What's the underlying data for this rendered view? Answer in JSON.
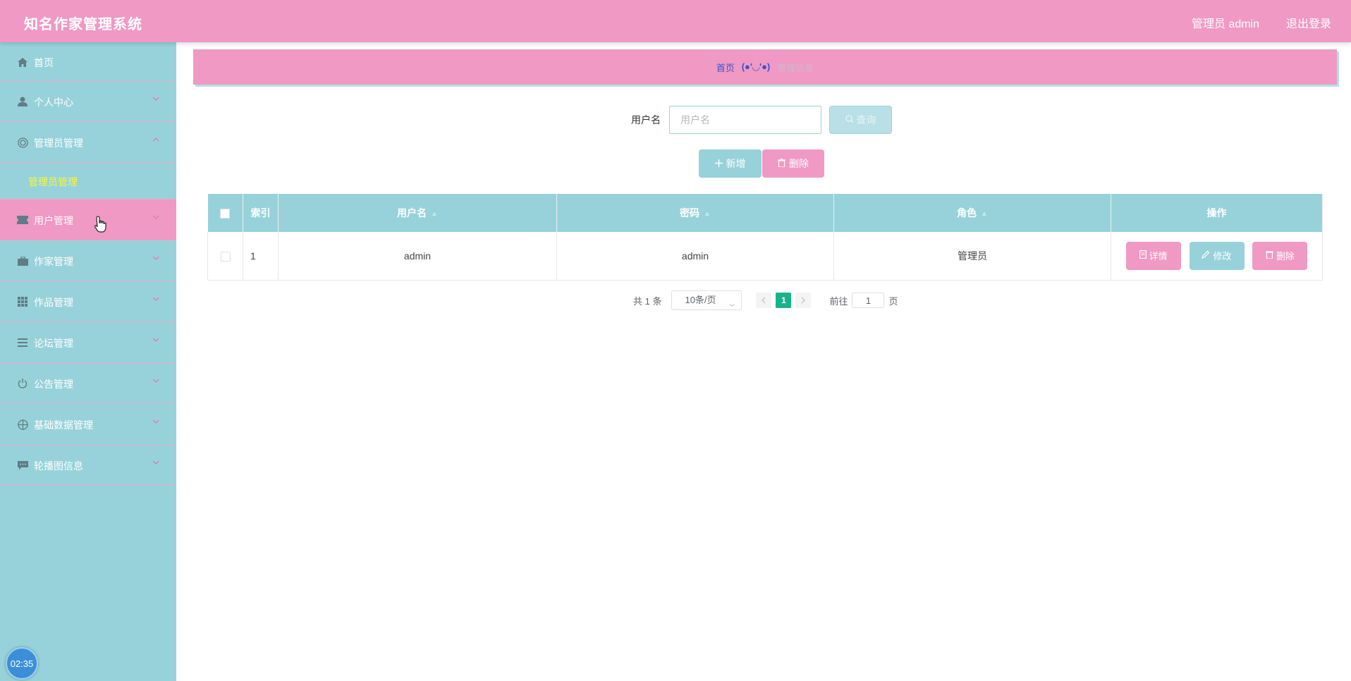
{
  "header": {
    "title": "知名作家管理系统",
    "user": "管理员 admin",
    "logout": "退出登录"
  },
  "sidebar": {
    "items": [
      {
        "label": "首页",
        "icon": "home-icon"
      },
      {
        "label": "个人中心",
        "icon": "user-icon"
      },
      {
        "label": "管理员管理",
        "icon": "admin-icon",
        "expanded": true,
        "children": [
          "管理员管理"
        ]
      },
      {
        "label": "用户管理",
        "icon": "ticket-icon",
        "active": true
      },
      {
        "label": "作家管理",
        "icon": "briefcase-icon"
      },
      {
        "label": "作品管理",
        "icon": "grid-icon"
      },
      {
        "label": "论坛管理",
        "icon": "list-icon"
      },
      {
        "label": "公告管理",
        "icon": "power-icon"
      },
      {
        "label": "基础数据管理",
        "icon": "target-icon"
      },
      {
        "label": "轮播图信息",
        "icon": "chat-icon"
      }
    ],
    "clock": "02:35"
  },
  "breadcrumb": {
    "home": "首页",
    "face": "(●'◡'●)",
    "current": "管理信息"
  },
  "search": {
    "label": "用户名",
    "placeholder": "用户名",
    "button": "查询"
  },
  "actions": {
    "add": "新增",
    "delete": "删除"
  },
  "table": {
    "headers": [
      "索引",
      "用户名",
      "密码",
      "角色",
      "操作"
    ],
    "rows": [
      {
        "index": "1",
        "username": "admin",
        "password": "admin",
        "role": "管理员"
      }
    ],
    "row_actions": {
      "detail": "详情",
      "edit": "修改",
      "delete": "删除"
    }
  },
  "pagination": {
    "total": "共 1 条",
    "page_size": "10条/页",
    "current_page": "1",
    "goto_label": "前往",
    "goto_value": "1",
    "page_suffix": "页"
  },
  "colors": {
    "pink": "#ef99c4",
    "teal": "#97d2da",
    "highlight_yellow": "#f7f73a",
    "page_active": "#19b38b"
  }
}
